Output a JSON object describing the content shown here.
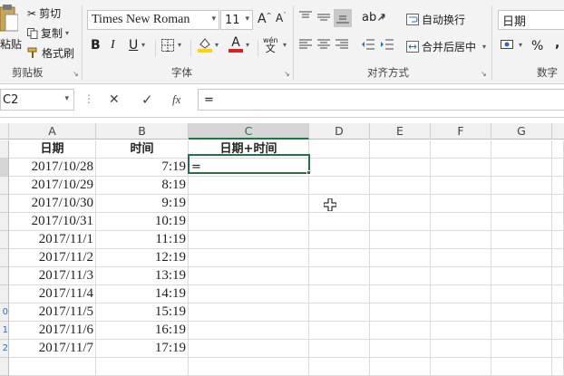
{
  "ribbon": {
    "clipboard": {
      "paste_label": "粘贴",
      "cut_label": "剪切",
      "copy_label": "复制",
      "format_painter_label": "格式刷",
      "group_label": "剪贴板"
    },
    "font": {
      "font_name": "Times New Roman",
      "font_size": "11",
      "bold": "B",
      "italic": "I",
      "underline": "U",
      "font_color_glyph": "A",
      "phonetic_glyph": "wén",
      "group_label": "字体"
    },
    "alignment": {
      "wrap_text_label": "自动换行",
      "merge_center_label": "合并后居中",
      "group_label": "对齐方式"
    },
    "number": {
      "format_value": "日期",
      "percent": "%",
      "comma": ",",
      "group_label": "数字"
    },
    "colors": {
      "accent": "#217346",
      "fill_yellow": "#ffd200",
      "font_red": "#e02020"
    }
  },
  "formula_bar": {
    "name_box": "C2",
    "cancel_glyph": "✕",
    "enter_glyph": "✓",
    "fx_label": "fx",
    "formula": "="
  },
  "sheet": {
    "columns": [
      "A",
      "B",
      "C",
      "D",
      "E",
      "F",
      "G"
    ],
    "row_numbers": [
      "",
      "",
      "",
      "",
      "",
      "",
      "",
      "",
      "",
      "0",
      "1",
      "2",
      ""
    ],
    "headers": [
      "日期",
      "时间",
      "日期+时间"
    ],
    "rows": [
      {
        "date": "2017/10/28",
        "time": "7:19",
        "combo": "="
      },
      {
        "date": "2017/10/29",
        "time": "8:19",
        "combo": ""
      },
      {
        "date": "2017/10/30",
        "time": "9:19",
        "combo": ""
      },
      {
        "date": "2017/10/31",
        "time": "10:19",
        "combo": ""
      },
      {
        "date": "2017/11/1",
        "time": "11:19",
        "combo": ""
      },
      {
        "date": "2017/11/2",
        "time": "12:19",
        "combo": ""
      },
      {
        "date": "2017/11/3",
        "time": "13:19",
        "combo": ""
      },
      {
        "date": "2017/11/4",
        "time": "14:19",
        "combo": ""
      },
      {
        "date": "2017/11/5",
        "time": "15:19",
        "combo": ""
      },
      {
        "date": "2017/11/6",
        "time": "16:19",
        "combo": ""
      },
      {
        "date": "2017/11/7",
        "time": "17:19",
        "combo": ""
      }
    ]
  }
}
